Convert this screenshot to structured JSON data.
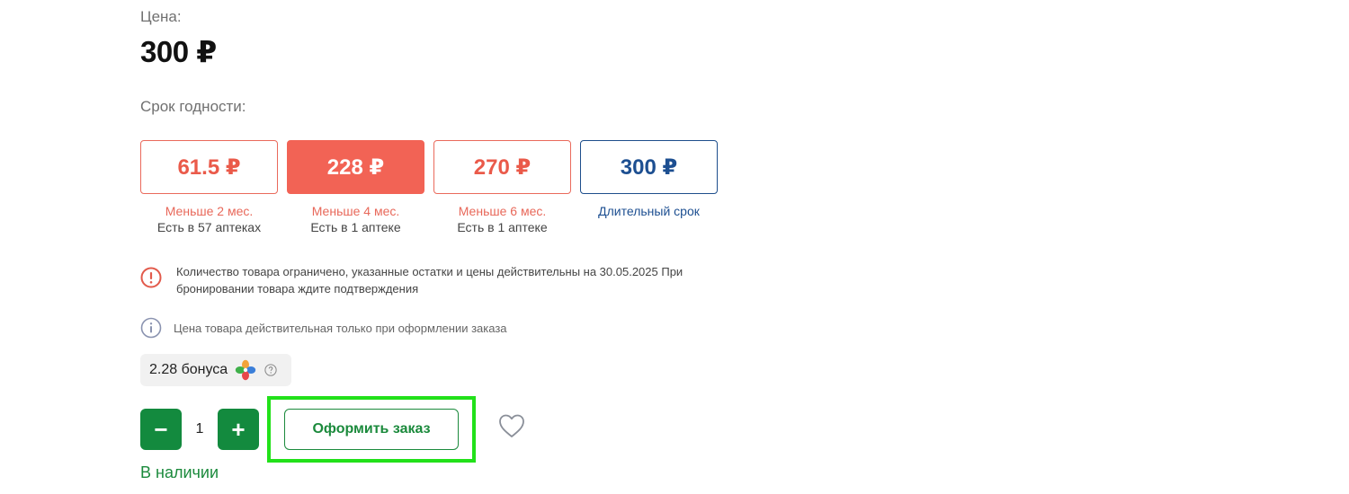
{
  "price": {
    "label": "Цена:",
    "value": "300 ₽"
  },
  "expiry": {
    "label": "Срок годности:",
    "options": [
      {
        "price": "61.5 ₽",
        "term": "Меньше 2 мес.",
        "stock": "Есть в 57 аптеках",
        "selected": false
      },
      {
        "price": "228 ₽",
        "term": "Меньше 4 мес.",
        "stock": "Есть в 1 аптеке",
        "selected": true
      },
      {
        "price": "270 ₽",
        "term": "Меньше 6 мес.",
        "stock": "Есть в 1 аптеке",
        "selected": false
      },
      {
        "price": "300 ₽",
        "term": "Длительный срок",
        "stock": "",
        "selected": false
      }
    ]
  },
  "notices": {
    "limited": "Количество товара ограничено, указанные остатки и цены действительны на 30.05.2025 При бронировании товара ждите подтверждения",
    "price_info": "Цена товара действительная только при оформлении заказа"
  },
  "bonus": {
    "text": "2.28 бонуса",
    "logo_icon": "clover-logo-icon",
    "help_icon": "question-circle-icon"
  },
  "cart": {
    "minus": "−",
    "quantity": "1",
    "plus": "+",
    "order_button": "Оформить заказ",
    "favorite_icon": "heart-outline-icon"
  },
  "availability": "В наличии",
  "colors": {
    "accent_red": "#f26355",
    "accent_blue": "#1d4f91",
    "accent_green": "#138a3e",
    "highlight": "#22e11a"
  }
}
